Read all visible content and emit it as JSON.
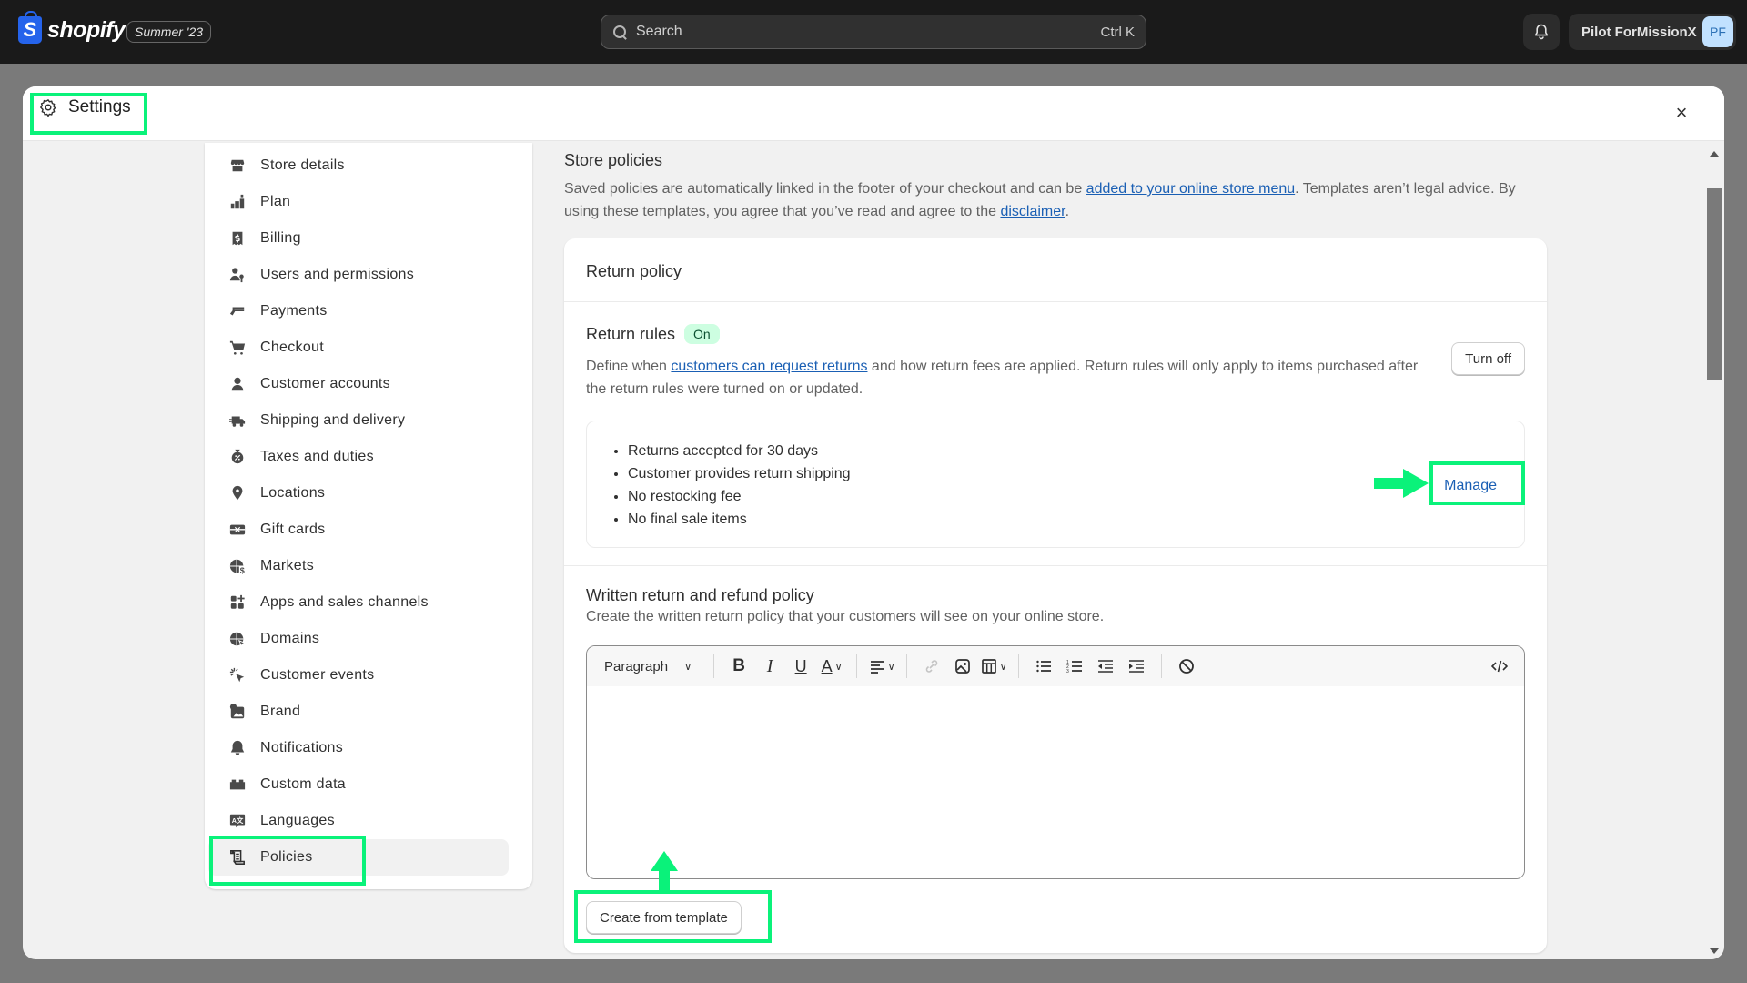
{
  "topbar": {
    "brand": "shopify",
    "edition": "Summer '23",
    "search_placeholder": "Search",
    "search_shortcut": "Ctrl K",
    "user_name": "Pilot ForMissionX",
    "user_initials": "PF"
  },
  "modal": {
    "title": "Settings",
    "close_label": "×"
  },
  "sidebar": {
    "items": [
      {
        "label": "Store details",
        "icon": "store-icon"
      },
      {
        "label": "Plan",
        "icon": "plan-icon"
      },
      {
        "label": "Billing",
        "icon": "billing-icon"
      },
      {
        "label": "Users and permissions",
        "icon": "users-icon"
      },
      {
        "label": "Payments",
        "icon": "payments-icon"
      },
      {
        "label": "Checkout",
        "icon": "cart-icon"
      },
      {
        "label": "Customer accounts",
        "icon": "person-icon"
      },
      {
        "label": "Shipping and delivery",
        "icon": "truck-icon"
      },
      {
        "label": "Taxes and duties",
        "icon": "tax-icon"
      },
      {
        "label": "Locations",
        "icon": "location-icon"
      },
      {
        "label": "Gift cards",
        "icon": "gift-card-icon"
      },
      {
        "label": "Markets",
        "icon": "globe-dollar-icon"
      },
      {
        "label": "Apps and sales channels",
        "icon": "apps-icon"
      },
      {
        "label": "Domains",
        "icon": "globe-cursor-icon"
      },
      {
        "label": "Customer events",
        "icon": "click-icon"
      },
      {
        "label": "Brand",
        "icon": "brand-icon"
      },
      {
        "label": "Notifications",
        "icon": "bell-icon"
      },
      {
        "label": "Custom data",
        "icon": "blocks-icon"
      },
      {
        "label": "Languages",
        "icon": "translate-icon"
      },
      {
        "label": "Policies",
        "icon": "scroll-icon",
        "active": true
      }
    ]
  },
  "store_policies": {
    "title": "Store policies",
    "desc_part1": "Saved policies are automatically linked in the footer of your checkout and can be ",
    "desc_link1": "added to your online store menu",
    "desc_part2": ". Templates aren’t legal advice. By using these templates, you agree that you’ve read and agree to the ",
    "desc_link2": "disclaimer",
    "desc_part3": "."
  },
  "return_policy": {
    "title": "Return policy",
    "rules_title": "Return rules",
    "rules_status": "On",
    "rules_desc_part1": "Define when ",
    "rules_desc_link": "customers can request returns",
    "rules_desc_part2": " and how return fees are applied. Return rules will only apply to items purchased after the return rules were turned on or updated.",
    "turn_off_label": "Turn off",
    "rules_list": [
      "Returns accepted for 30 days",
      "Customer provides return shipping",
      "No restocking fee",
      "No final sale items"
    ],
    "manage_label": "Manage",
    "written_title": "Written return and refund policy",
    "written_desc": "Create the written return policy that your customers will see on your online store.",
    "editor_format": "Paragraph",
    "create_template_label": "Create from template"
  },
  "colors": {
    "highlight": "#0af27a",
    "link": "#1a5fb4",
    "badge_bg": "#cdfee1",
    "topbar": "#1a1a1a"
  }
}
